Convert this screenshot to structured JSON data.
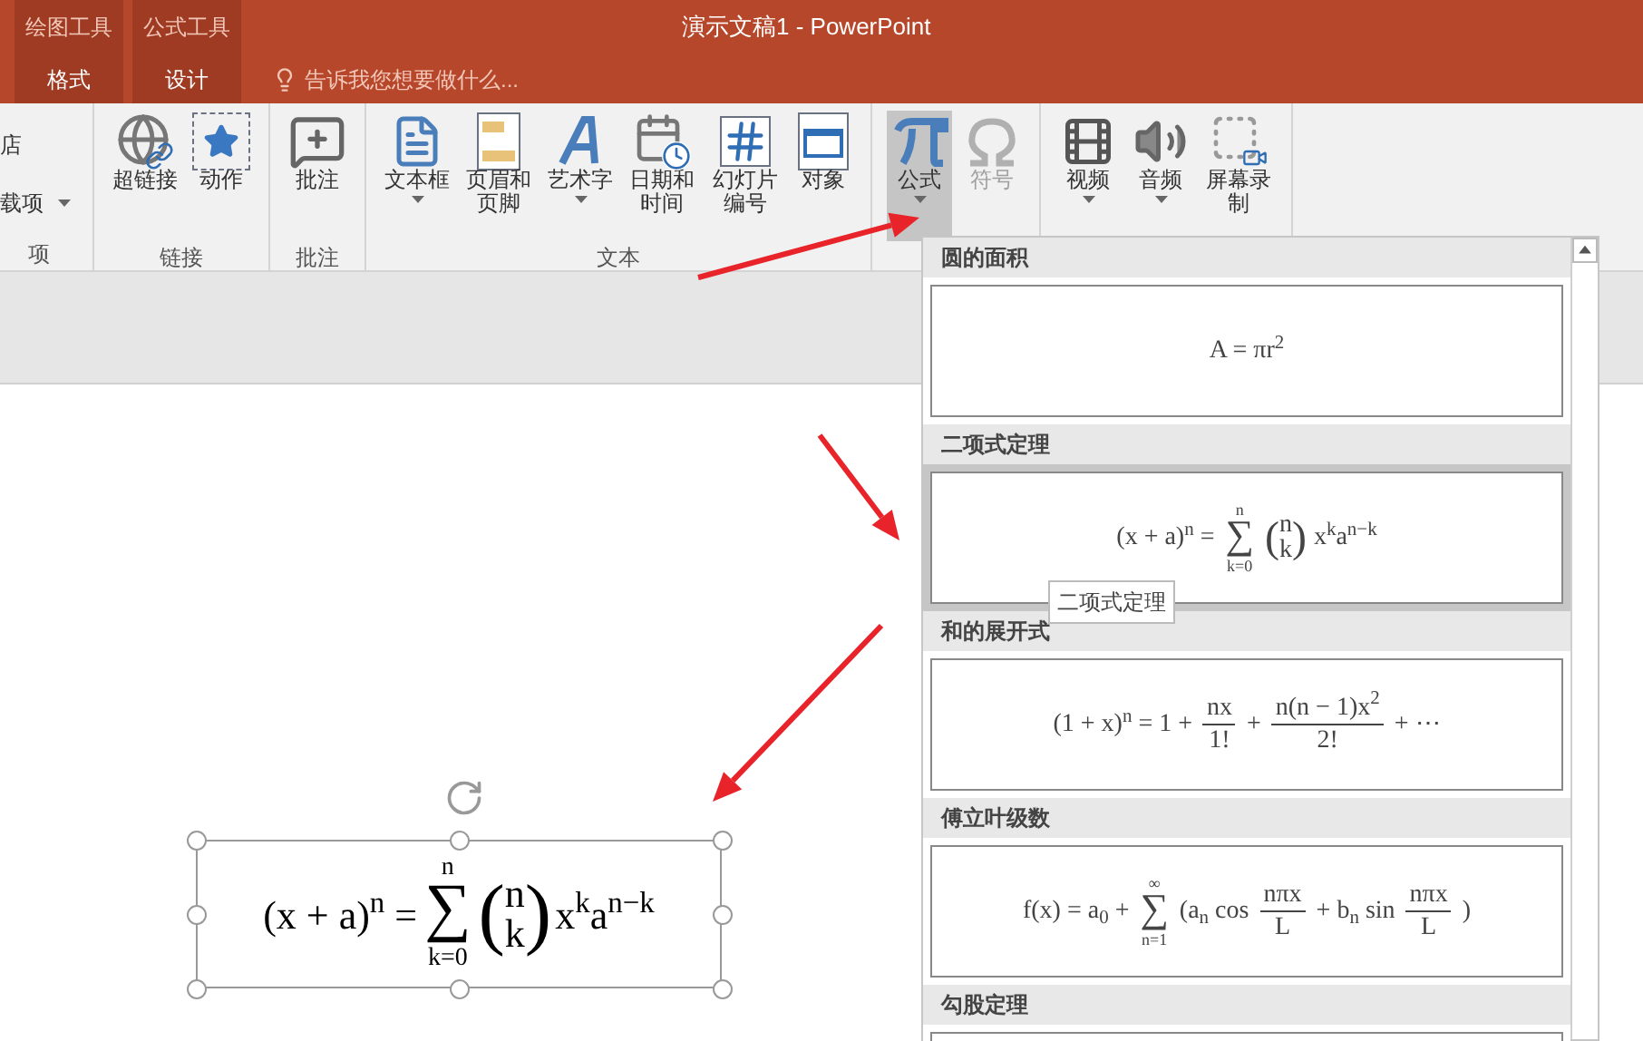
{
  "window": {
    "title": "演示文稿1 - PowerPoint"
  },
  "context_tabs": [
    {
      "group": "绘图工具",
      "tab": "格式"
    },
    {
      "group": "公式工具",
      "tab": "设计"
    }
  ],
  "tell_me": {
    "placeholder": "告诉我您想要做什么..."
  },
  "ribbon": {
    "groups": [
      {
        "label": "项",
        "buttons": [
          {
            "kind": "small",
            "label": "店",
            "dropdown": false
          },
          {
            "kind": "small",
            "label": "载项",
            "dropdown": true
          }
        ]
      },
      {
        "label": "链接",
        "buttons": [
          {
            "kind": "globe",
            "label": "超链接",
            "dropdown": false
          },
          {
            "kind": "star",
            "label": "动作",
            "dropdown": false
          }
        ]
      },
      {
        "label": "批注",
        "buttons": [
          {
            "kind": "comment",
            "label": "批注",
            "dropdown": false
          }
        ]
      },
      {
        "label": "文本",
        "buttons": [
          {
            "kind": "textbox",
            "label": "文本框",
            "dropdown": true
          },
          {
            "kind": "page",
            "label": "页眉和页脚",
            "dropdown": false
          },
          {
            "kind": "wordart",
            "label": "艺术字",
            "dropdown": true
          },
          {
            "kind": "calendar",
            "label": "日期和时间",
            "dropdown": false
          },
          {
            "kind": "hash",
            "label": "幻灯片编号",
            "dropdown": false
          },
          {
            "kind": "object",
            "label": "对象",
            "dropdown": false
          }
        ]
      },
      {
        "buttons": [
          {
            "kind": "pi",
            "label": "公式",
            "dropdown": true,
            "pressed": true,
            "disabled": false
          },
          {
            "kind": "omega",
            "label": "符号",
            "dropdown": false,
            "pressed": false,
            "disabled": true
          }
        ]
      },
      {
        "buttons": [
          {
            "kind": "film",
            "label": "视频",
            "dropdown": true
          },
          {
            "kind": "speaker",
            "label": "音频",
            "dropdown": true
          },
          {
            "kind": "record",
            "label": "屏幕录制",
            "dropdown": false
          }
        ]
      }
    ]
  },
  "slide": {
    "equation": {
      "selected": true,
      "formula": [
        {
          "kind": "text",
          "text": "(x + a)$^{n}$ ="
        },
        {
          "kind": "sum",
          "symbol": "∑",
          "over": "n",
          "under": "k=0"
        },
        {
          "kind": "binom",
          "open": "(",
          "top": "n",
          "bottom": "k",
          "close": ")"
        },
        {
          "kind": "text",
          "text": "x$^{k}$a$^{n−k}$"
        }
      ]
    }
  },
  "gallery": {
    "tooltip": "二项式定理",
    "items": [
      {
        "title": "圆的面积",
        "selected": false,
        "formula": [
          {
            "kind": "text",
            "text": "A = πr$^{2}$"
          }
        ]
      },
      {
        "title": "二项式定理",
        "selected": true,
        "formula": [
          {
            "kind": "text",
            "text": "(x + a)$^{n}$ ="
          },
          {
            "kind": "sum",
            "symbol": "∑",
            "over": "n",
            "under": "k=0"
          },
          {
            "kind": "binom",
            "open": "(",
            "top": "n",
            "bottom": "k",
            "close": ")"
          },
          {
            "kind": "text",
            "text": "x$^{k}$a$^{n−k}$"
          }
        ]
      },
      {
        "title": "和的展开式",
        "selected": false,
        "formula": [
          {
            "kind": "text",
            "text": "(1 + x)$^{n}$ = 1 +"
          },
          {
            "kind": "frac",
            "num": "nx",
            "den": "1!"
          },
          {
            "kind": "text",
            "text": "+"
          },
          {
            "kind": "frac",
            "num": "n(n − 1)x$^{2}$",
            "den": "2!"
          },
          {
            "kind": "text",
            "text": "+ ⋯"
          }
        ]
      },
      {
        "title": "傅立叶级数",
        "selected": false,
        "formula": [
          {
            "kind": "text",
            "text": "f(x) = a$_{0}$ +"
          },
          {
            "kind": "sum",
            "symbol": "∑",
            "over": "∞",
            "under": "n=1"
          },
          {
            "kind": "text",
            "text": "(a$_{n}$ cos"
          },
          {
            "kind": "frac",
            "num": "nπx",
            "den": "L"
          },
          {
            "kind": "text",
            "text": "+ b$_{n}$ sin"
          },
          {
            "kind": "frac",
            "num": "nπx",
            "den": "L"
          },
          {
            "kind": "text",
            "text": ")"
          }
        ]
      },
      {
        "title": "勾股定理",
        "selected": false
      }
    ]
  }
}
